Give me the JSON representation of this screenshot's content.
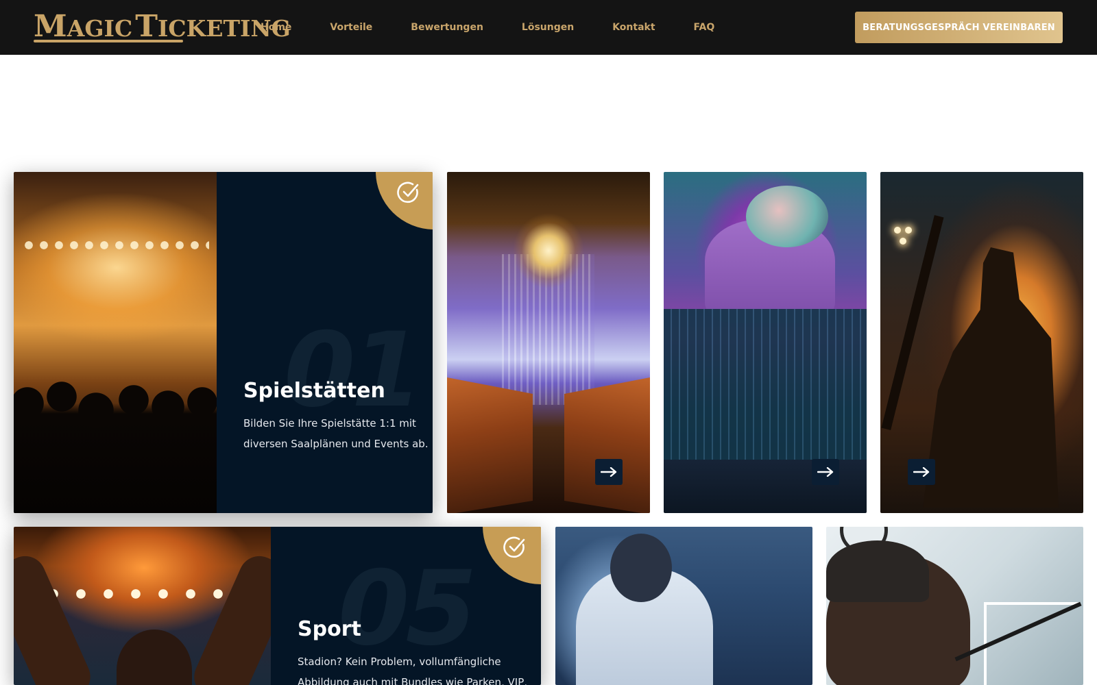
{
  "header": {
    "logo": {
      "part1_big": "M",
      "part1_rest": "AGIC",
      "part2_big": "T",
      "part2_rest": "ICKETING"
    },
    "nav": [
      "Home",
      "Vorteile",
      "Bewertungen",
      "Lösungen",
      "Kontakt",
      "FAQ"
    ],
    "cta_label": "BERATUNGSGESPRÄCH VEREINBAREN"
  },
  "colors": {
    "header_bg": "#141414",
    "accent_gold": "#c79d55",
    "card_panel": "#041526"
  },
  "cards_row1": {
    "featured": {
      "number": "01",
      "title": "Spielstätten",
      "text_line1": "Bilden Sie Ihre Spielstätte 1:1 mit",
      "text_line2": "diversen Saalplänen und Events ab.",
      "image": "concert-crowd",
      "icon": "check-circle-icon"
    },
    "tiles": [
      {
        "image": "event-hall-chandelier",
        "icon": "arrow-right-icon"
      },
      {
        "image": "dj-mixing",
        "icon": "arrow-right-icon"
      },
      {
        "image": "guitarist-silhouette",
        "icon": "arrow-right-icon"
      }
    ]
  },
  "cards_row2": {
    "featured": {
      "number": "05",
      "title": "Sport",
      "text_line1": "Stadion? Kein Problem, vollumfängliche",
      "text_line2": "Abbildung auch mit Bundles wie Parken, VIP,",
      "image": "stadium-fan",
      "icon": "check-circle-icon"
    },
    "tiles": [
      {
        "image": "speaker-on-stage"
      },
      {
        "image": "podcast-studio"
      }
    ]
  }
}
